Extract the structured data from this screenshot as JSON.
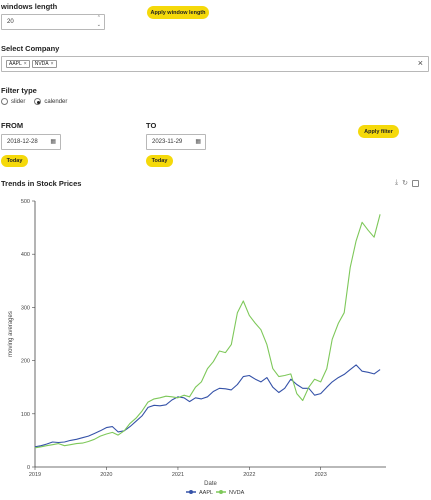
{
  "window_length": {
    "label": "windows length",
    "value": "20",
    "apply_label": "Apply window length"
  },
  "company": {
    "label": "Select Company",
    "selected": [
      "AAPL",
      "NVDA"
    ],
    "clear_icon": "close-icon"
  },
  "filter_type": {
    "label": "Filter type",
    "options": [
      "slider",
      "calender"
    ],
    "selected": "calender"
  },
  "from": {
    "label": "FROM",
    "value": "2018-12-28",
    "today_label": "Today"
  },
  "to": {
    "label": "TO",
    "value": "2023-11-29",
    "today_label": "Today"
  },
  "apply_filter_label": "Apply filter",
  "chart_title": "Trends in Stock Prices",
  "toolbar_icons": [
    "download-icon",
    "restore-icon",
    "fullscreen-icon"
  ],
  "chart_data": {
    "type": "line",
    "xlabel": "Date",
    "ylabel": "moving averages",
    "xlim": [
      "2019-01-01",
      "2023-12-01"
    ],
    "x_ticks": [
      "2019",
      "2020",
      "2021",
      "2022",
      "2023"
    ],
    "ylim": [
      0,
      500
    ],
    "y_ticks": [
      0,
      100,
      200,
      300,
      400,
      500
    ],
    "grid": false,
    "legend": "bottom-center",
    "x": [
      "2019-01",
      "2019-02",
      "2019-03",
      "2019-04",
      "2019-05",
      "2019-06",
      "2019-07",
      "2019-08",
      "2019-09",
      "2019-10",
      "2019-11",
      "2019-12",
      "2020-01",
      "2020-02",
      "2020-03",
      "2020-04",
      "2020-05",
      "2020-06",
      "2020-07",
      "2020-08",
      "2020-09",
      "2020-10",
      "2020-11",
      "2020-12",
      "2021-01",
      "2021-02",
      "2021-03",
      "2021-04",
      "2021-05",
      "2021-06",
      "2021-07",
      "2021-08",
      "2021-09",
      "2021-10",
      "2021-11",
      "2021-12",
      "2022-01",
      "2022-02",
      "2022-03",
      "2022-04",
      "2022-05",
      "2022-06",
      "2022-07",
      "2022-08",
      "2022-09",
      "2022-10",
      "2022-11",
      "2022-12",
      "2023-01",
      "2023-02",
      "2023-03",
      "2023-04",
      "2023-05",
      "2023-06",
      "2023-07",
      "2023-08",
      "2023-09",
      "2023-10",
      "2023-11"
    ],
    "series": [
      {
        "name": "AAPL",
        "color": "#3552a8",
        "values": [
          38,
          40,
          43,
          47,
          46,
          47,
          50,
          52,
          55,
          58,
          63,
          68,
          74,
          76,
          66,
          68,
          76,
          86,
          96,
          112,
          116,
          115,
          117,
          126,
          132,
          130,
          123,
          130,
          128,
          132,
          142,
          148,
          147,
          145,
          155,
          170,
          172,
          165,
          160,
          168,
          150,
          140,
          148,
          165,
          155,
          148,
          148,
          135,
          138,
          150,
          160,
          168,
          174,
          183,
          192,
          180,
          178,
          175,
          183
        ]
      },
      {
        "name": "NVDA",
        "color": "#7ec85a",
        "values": [
          36,
          38,
          40,
          42,
          44,
          40,
          42,
          44,
          45,
          48,
          52,
          58,
          62,
          65,
          60,
          68,
          82,
          92,
          105,
          122,
          128,
          130,
          133,
          132,
          130,
          135,
          132,
          150,
          160,
          185,
          198,
          218,
          215,
          230,
          290,
          312,
          285,
          270,
          258,
          230,
          185,
          170,
          172,
          175,
          138,
          125,
          150,
          165,
          160,
          185,
          240,
          270,
          290,
          375,
          425,
          460,
          445,
          432,
          475
        ]
      }
    ]
  }
}
